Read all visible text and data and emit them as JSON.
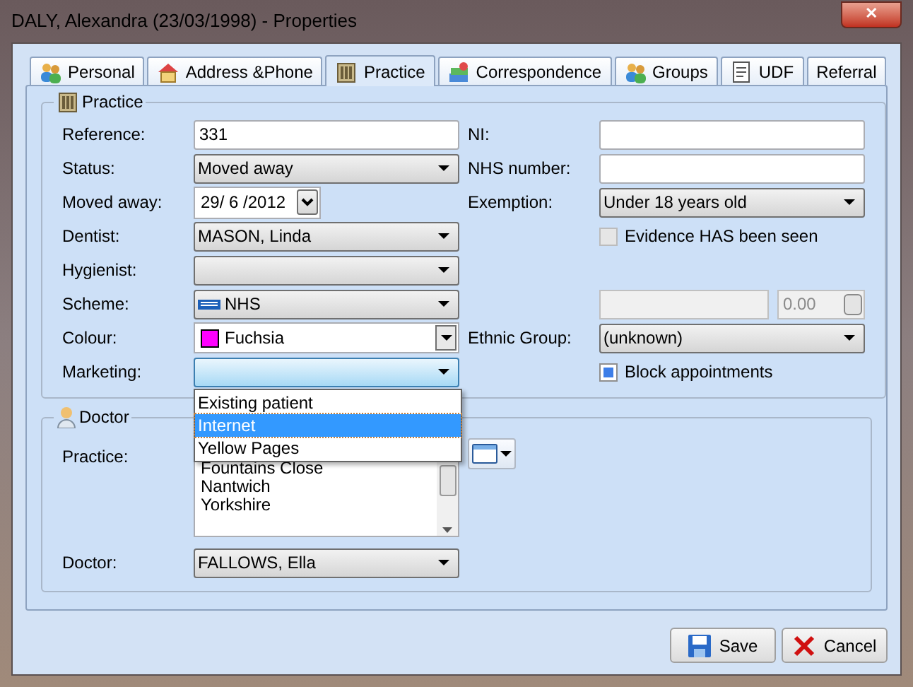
{
  "window": {
    "title": "DALY, Alexandra (23/03/1998) - Properties",
    "close": "✕"
  },
  "tabs": [
    {
      "label": "Personal",
      "selected": false
    },
    {
      "label": "Address &Phone",
      "selected": false
    },
    {
      "label": "Practice",
      "selected": true
    },
    {
      "label": "Correspondence",
      "selected": false
    },
    {
      "label": "Groups",
      "selected": false
    },
    {
      "label": "UDF",
      "selected": false
    },
    {
      "label": "Referral",
      "selected": false
    }
  ],
  "practice_group": {
    "title": "Practice",
    "rows": [
      {
        "left": {
          "label": "Reference:",
          "kind": "text",
          "value": "331"
        },
        "right": {
          "label": "NI:",
          "kind": "text"
        }
      },
      {
        "left": {
          "label": "Status:",
          "kind": "combo",
          "value": "Moved away"
        },
        "right": {
          "label": "NHS number:",
          "kind": "text"
        }
      },
      {
        "left": {
          "label": "Moved away:",
          "kind": "date",
          "value": "29/ 6 /2012"
        },
        "right": {
          "label": "Exemption:",
          "kind": "combo",
          "value": "Under 18 years old"
        }
      },
      {
        "left": {
          "label": "Dentist:",
          "kind": "combo",
          "value": "MASON, Linda"
        },
        "right": {
          "kind": "checkbox",
          "text": "Evidence HAS been seen",
          "checked": false,
          "disabled": true
        }
      },
      {
        "left": {
          "label": "Hygienist:",
          "kind": "combo"
        }
      },
      {
        "left": {
          "label": "Scheme:",
          "kind": "scheme",
          "value": "NHS"
        },
        "right": {
          "kind": "disabled_pair",
          "value": "0.00",
          "disabled": true
        }
      },
      {
        "left": {
          "label": "Colour:",
          "kind": "colour",
          "value": "Fuchsia",
          "color": "#ff00ff"
        },
        "right": {
          "label": "Ethnic Group:",
          "kind": "combo",
          "value": "(unknown)"
        }
      },
      {
        "left": {
          "label": "Marketing:",
          "kind": "combo",
          "focused": true,
          "options": [
            {
              "label": "Existing patient",
              "selected": false
            },
            {
              "label": "Internet",
              "selected": true
            },
            {
              "label": "Yellow Pages",
              "selected": false
            }
          ]
        },
        "right": {
          "kind": "checkbox",
          "text": "Block appointments",
          "checked": true,
          "disabled": false
        }
      }
    ]
  },
  "doctor_group": {
    "title": "Doctor",
    "practice_label": "Practice:",
    "practice_list": [
      "Fountains Close",
      "Nantwich",
      "Yorkshire"
    ],
    "doctor_label": "Doctor:",
    "doctor": "FALLOWS, Ella"
  },
  "buttons": [
    {
      "label": "Save",
      "kind": "save"
    },
    {
      "label": "Cancel",
      "kind": "cancel"
    }
  ]
}
